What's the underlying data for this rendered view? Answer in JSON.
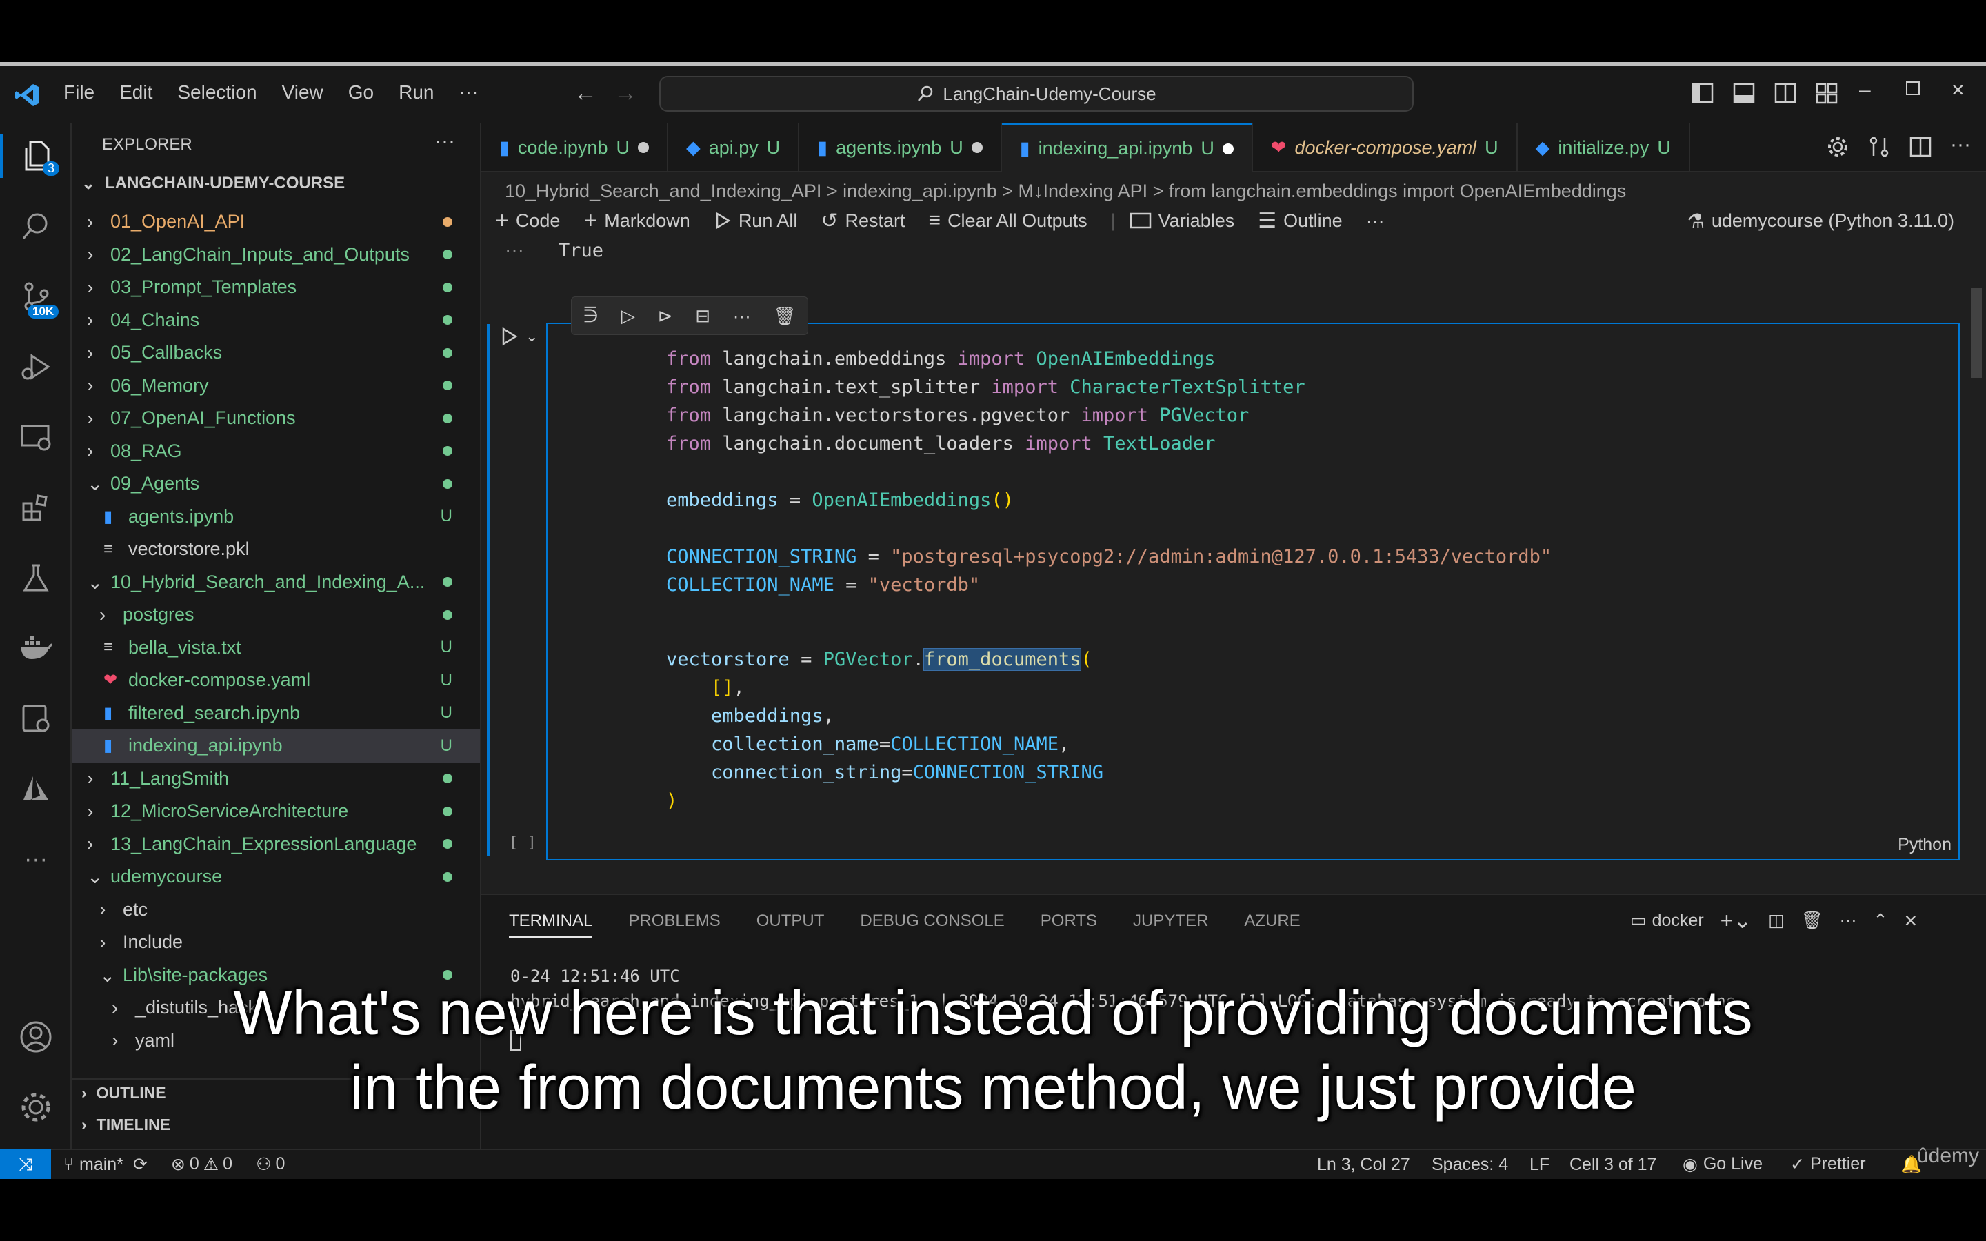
{
  "menu": {
    "items": [
      "File",
      "Edit",
      "Selection",
      "View",
      "Go",
      "Run",
      "···"
    ],
    "search": "LangChain-Udemy-Course"
  },
  "activity": {
    "explorer_badge": "3",
    "scm_badge": "10K"
  },
  "explorer": {
    "title": "EXPLORER",
    "more": "···",
    "root": "LANGCHAIN-UDEMY-COURSE",
    "items": [
      {
        "label": "01_OpenAI_API",
        "type": "folder",
        "chev": ">",
        "indent": 0,
        "color": "#e8ab6a"
      },
      {
        "label": "02_LangChain_Inputs_and_Outputs",
        "type": "folder",
        "chev": ">",
        "indent": 0,
        "color": "#73c991"
      },
      {
        "label": "03_Prompt_Templates",
        "type": "folder",
        "chev": ">",
        "indent": 0,
        "color": "#73c991"
      },
      {
        "label": "04_Chains",
        "type": "folder",
        "chev": ">",
        "indent": 0,
        "color": "#73c991"
      },
      {
        "label": "05_Callbacks",
        "type": "folder",
        "chev": ">",
        "indent": 0,
        "color": "#73c991"
      },
      {
        "label": "06_Memory",
        "type": "folder",
        "chev": ">",
        "indent": 0,
        "color": "#73c991"
      },
      {
        "label": "07_OpenAI_Functions",
        "type": "folder",
        "chev": ">",
        "indent": 0,
        "color": "#73c991"
      },
      {
        "label": "08_RAG",
        "type": "folder",
        "chev": ">",
        "indent": 0,
        "color": "#73c991"
      },
      {
        "label": "09_Agents",
        "type": "folder",
        "chev": "v",
        "indent": 0,
        "color": "#73c991"
      },
      {
        "label": "agents.ipynb",
        "type": "nb",
        "badge": "U",
        "indent": 1,
        "color": "#73c991"
      },
      {
        "label": "vectorstore.pkl",
        "type": "txt",
        "indent": 1,
        "color": "#cccccc"
      },
      {
        "label": "10_Hybrid_Search_and_Indexing_A...",
        "type": "folder",
        "chev": "v",
        "indent": 0,
        "color": "#73c991"
      },
      {
        "label": "postgres",
        "type": "folder",
        "chev": ">",
        "indent": 1,
        "color": "#73c991"
      },
      {
        "label": "bella_vista.txt",
        "type": "txt",
        "badge": "U",
        "indent": 1,
        "color": "#73c991"
      },
      {
        "label": "docker-compose.yaml",
        "type": "yaml",
        "badge": "U",
        "indent": 1,
        "color": "#73c991"
      },
      {
        "label": "filtered_search.ipynb",
        "type": "nb",
        "badge": "U",
        "indent": 1,
        "color": "#73c991"
      },
      {
        "label": "indexing_api.ipynb",
        "type": "nb",
        "badge": "U",
        "indent": 1,
        "color": "#73c991",
        "selected": true
      },
      {
        "label": "11_LangSmith",
        "type": "folder",
        "chev": ">",
        "indent": 0,
        "color": "#73c991"
      },
      {
        "label": "12_MicroServiceArchitecture",
        "type": "folder",
        "chev": ">",
        "indent": 0,
        "color": "#73c991"
      },
      {
        "label": "13_LangChain_ExpressionLanguage",
        "type": "folder",
        "chev": ">",
        "indent": 0,
        "color": "#73c991"
      },
      {
        "label": "udemycourse",
        "type": "folder",
        "chev": "v",
        "indent": 0,
        "color": "#73c991"
      },
      {
        "label": "etc",
        "type": "folder",
        "chev": ">",
        "indent": 1,
        "color": "#cccccc"
      },
      {
        "label": "Include",
        "type": "folder",
        "chev": ">",
        "indent": 1,
        "color": "#cccccc"
      },
      {
        "label": "Lib\\site-packages",
        "type": "folder",
        "chev": "v",
        "indent": 1,
        "color": "#73c991"
      },
      {
        "label": "_distutils_hack",
        "type": "folder",
        "chev": ">",
        "indent": 2,
        "color": "#cccccc"
      },
      {
        "label": "yaml",
        "type": "folder",
        "chev": ">",
        "indent": 2,
        "color": "#cccccc"
      }
    ],
    "outline": "OUTLINE",
    "timeline": "TIMELINE"
  },
  "tabs": [
    {
      "label": "code.ipynb",
      "badge": "U",
      "dot": true
    },
    {
      "label": "api.py",
      "badge": "U",
      "dot": false
    },
    {
      "label": "agents.ipynb",
      "badge": "U",
      "dot": true
    },
    {
      "label": "indexing_api.ipynb",
      "badge": "U",
      "dot": true,
      "active": true
    },
    {
      "label": "docker-compose.yaml",
      "badge": "U",
      "dot": false
    },
    {
      "label": "initialize.py",
      "badge": "U",
      "dot": false
    }
  ],
  "breadcrumbs": "10_Hybrid_Search_and_Indexing_API > indexing_api.ipynb > M↓Indexing API > from langchain.embeddings import OpenAIEmbeddings",
  "toolbar": {
    "code": "Code",
    "markdown": "Markdown",
    "run_all": "Run All",
    "restart": "Restart",
    "clear": "Clear All Outputs",
    "variables": "Variables",
    "outline": "Outline",
    "more": "···",
    "kernel": "udemycourse (Python 3.11.0)"
  },
  "prev_output": "True",
  "cell": {
    "exec_count": "[ ]",
    "language": "Python"
  },
  "panel": {
    "tabs": [
      "TERMINAL",
      "PROBLEMS",
      "OUTPUT",
      "DEBUG CONSOLE",
      "PORTS",
      "JUPYTER",
      "AZURE"
    ],
    "terminal_name": "docker",
    "line1": "0-24 12:51:46 UTC",
    "line2": "hybrid_search_and_indexing_api_postgres_1  | 2024-10-24 12:51:46.579 UTC [1] LOG:  database system is ready to accept conne"
  },
  "status": {
    "branch": "main*",
    "errors": "0",
    "warnings": "0",
    "ports": "0",
    "position": "Ln 3, Col 27",
    "spaces": "Spaces: 4",
    "eol": "LF",
    "cell": "Cell 3 of 17",
    "golive": "Go Live",
    "prettier": "Prettier"
  },
  "caption": {
    "line1": "What's new here is that instead of providing documents",
    "line2": "in the from documents method, we just provide"
  },
  "watermark": "ûdemy"
}
